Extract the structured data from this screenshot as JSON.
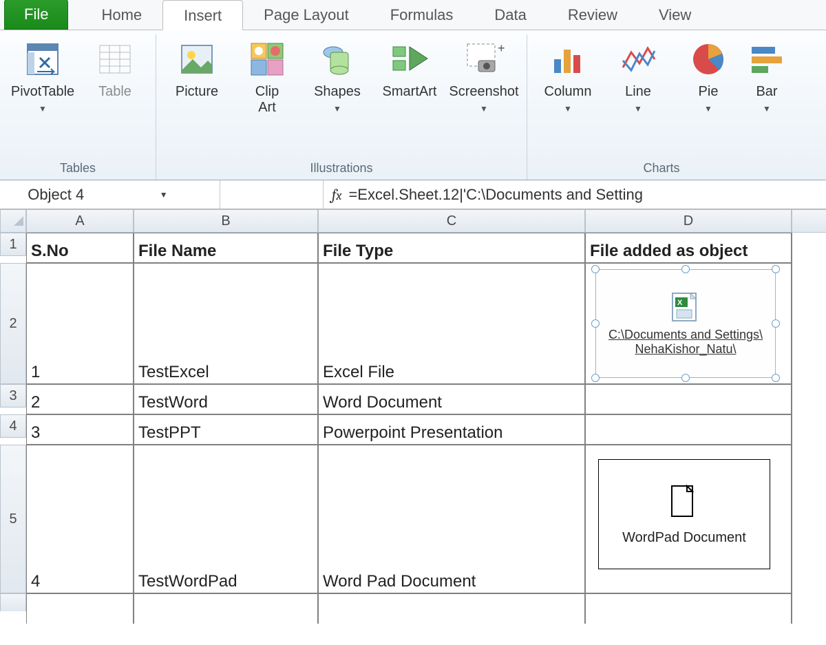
{
  "tabs": {
    "file": "File",
    "home": "Home",
    "insert": "Insert",
    "pagelayout": "Page Layout",
    "formulas": "Formulas",
    "data": "Data",
    "review": "Review",
    "view": "View"
  },
  "ribbon": {
    "groups": {
      "tables": "Tables",
      "illustrations": "Illustrations",
      "charts": "Charts"
    },
    "btn": {
      "pivottable": "PivotTable",
      "table": "Table",
      "picture": "Picture",
      "clipart": "Clip\nArt",
      "shapes": "Shapes",
      "smartart": "SmartArt",
      "screenshot": "Screenshot",
      "column": "Column",
      "line": "Line",
      "pie": "Pie",
      "bar": "Bar"
    }
  },
  "namebox": "Object 4",
  "formula": "=Excel.Sheet.12|'C:\\Documents and Setting",
  "cols": [
    "A",
    "B",
    "C",
    "D"
  ],
  "rows": [
    "1",
    "2",
    "3",
    "4",
    "5"
  ],
  "headers": {
    "A": "S.No",
    "B": "File Name",
    "C": "File Type",
    "D": "File added as object"
  },
  "data": [
    {
      "A": "1",
      "B": "TestExcel",
      "C": "Excel File"
    },
    {
      "A": "2",
      "B": "TestWord",
      "C": "Word Document"
    },
    {
      "A": "3",
      "B": "TestPPT",
      "C": "Powerpoint Presentation"
    },
    {
      "A": "4",
      "B": "TestWordPad",
      "C": "Word Pad Document"
    }
  ],
  "object1": {
    "caption": "C:\\Documents and Settings\\ NehaKishor_Natu\\"
  },
  "object2": {
    "caption": "WordPad Document"
  }
}
